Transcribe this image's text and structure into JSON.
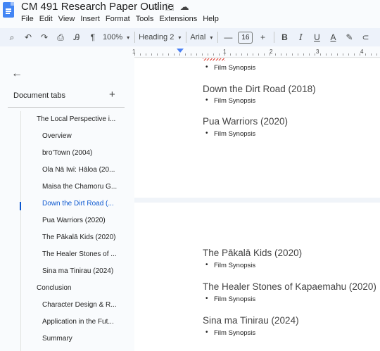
{
  "window": {
    "title": "CM 491 Research Paper Outline",
    "title_icons": [
      "star-icon",
      "folder-move-icon",
      "cloud-status-icon"
    ],
    "menu": [
      "File",
      "Edit",
      "View",
      "Insert",
      "Format",
      "Tools",
      "Extensions",
      "Help"
    ]
  },
  "toolbar": {
    "zoom": "100%",
    "style": "Heading 2",
    "font": "Arial",
    "font_size": "16",
    "minus": "—",
    "plus": "+",
    "bold": "B",
    "italic": "I",
    "underline": "U",
    "text_color": "A"
  },
  "ruler": {
    "labels": [
      "1",
      "1",
      "2",
      "3",
      "4"
    ]
  },
  "sidebar": {
    "back": "←",
    "header": "Document tabs",
    "add": "+",
    "items": [
      {
        "label": "The Local Perspective i...",
        "level": 1,
        "active": false
      },
      {
        "label": "Overview",
        "level": 2,
        "active": false
      },
      {
        "label": "bro'Town (2004)",
        "level": 2,
        "active": false
      },
      {
        "label": "Ola Nā Iwi: Hāloa (20...",
        "level": 2,
        "active": false
      },
      {
        "label": "Maisa the Chamoru G...",
        "level": 2,
        "active": false
      },
      {
        "label": "Down the Dirt Road (...",
        "level": 2,
        "active": true
      },
      {
        "label": "Pua Warriors (2020)",
        "level": 2,
        "active": false
      },
      {
        "label": "The Pākalā Kids (2020)",
        "level": 2,
        "active": false
      },
      {
        "label": "The Healer Stones of ...",
        "level": 2,
        "active": false
      },
      {
        "label": "Sina ma Tinirau (2024)",
        "level": 2,
        "active": false
      },
      {
        "label": "Conclusion",
        "level": 1,
        "active": false
      },
      {
        "label": "Character Design & R...",
        "level": 2,
        "active": false
      },
      {
        "label": "Application in the Fut...",
        "level": 2,
        "active": false
      },
      {
        "label": "Summary",
        "level": 2,
        "active": false
      }
    ]
  },
  "document": {
    "page1": [
      {
        "type": "bullet",
        "text": "Film Synopsis"
      },
      {
        "type": "heading",
        "text": "Down the Dirt Road (2018)"
      },
      {
        "type": "bullet",
        "text": "Film Synopsis"
      },
      {
        "type": "heading",
        "text": "Pua Warriors (2020)"
      },
      {
        "type": "bullet",
        "text": "Film Synopsis"
      }
    ],
    "page2": [
      {
        "type": "heading",
        "text": "The Pākalā Kids (2020)"
      },
      {
        "type": "bullet",
        "text": "Film Synopsis"
      },
      {
        "type": "heading",
        "text": "The Healer Stones of Kapaemahu (2020)"
      },
      {
        "type": "bullet",
        "text": "Film Synopsis"
      },
      {
        "type": "heading",
        "text": "Sina ma Tinirau (2024)"
      },
      {
        "type": "bullet",
        "text": "Film Synopsis"
      }
    ]
  },
  "colors": {
    "accent": "#0b57d0",
    "doc_blue": "#4285f4",
    "toolbar_bg": "#edf2fa"
  }
}
